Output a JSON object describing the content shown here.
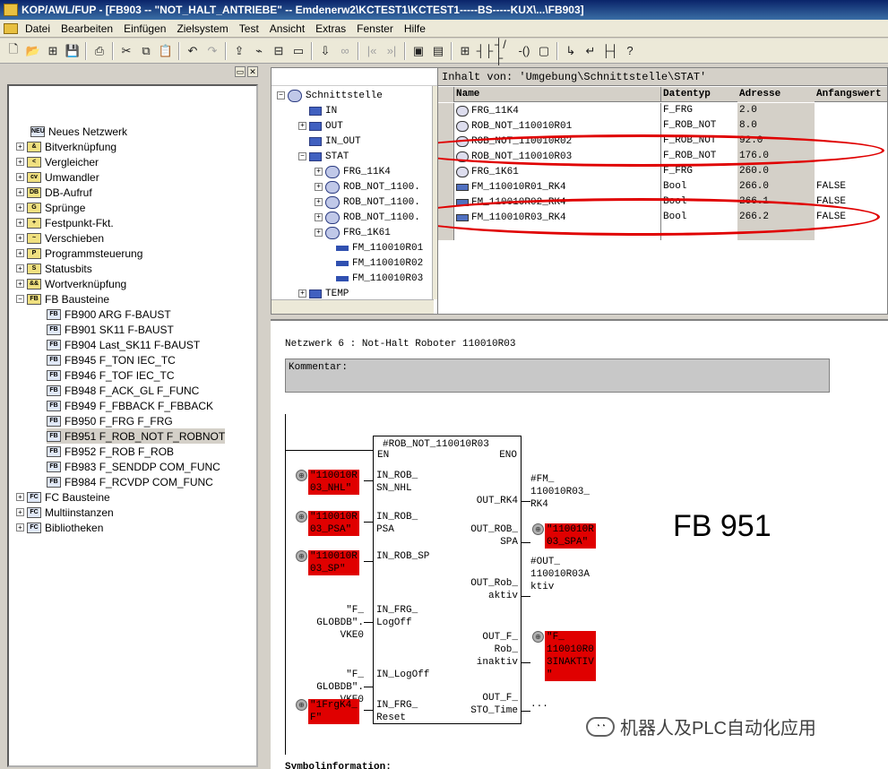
{
  "window": {
    "title": "KOP/AWL/FUP - [FB903 -- \"NOT_HALT_ANTRIEBE\" -- Emdenerw2\\KCTEST1\\KCTEST1-----BS-----KUX\\...\\FB903]"
  },
  "menu": [
    "Datei",
    "Bearbeiten",
    "Einfügen",
    "Zielsystem",
    "Test",
    "Ansicht",
    "Extras",
    "Fenster",
    "Hilfe"
  ],
  "toolbar": [
    {
      "icon": "new-icon",
      "glyph": "🗋"
    },
    {
      "icon": "open-icon",
      "glyph": "📂"
    },
    {
      "icon": "network-icon",
      "glyph": "⊞"
    },
    {
      "icon": "save-icon",
      "glyph": "💾"
    },
    {
      "icon": "print-icon",
      "glyph": "⎙"
    },
    {
      "icon": "cut-icon",
      "glyph": "✂"
    },
    {
      "icon": "copy-icon",
      "glyph": "⧉"
    },
    {
      "icon": "paste-icon",
      "glyph": "📋"
    },
    {
      "icon": "undo-icon",
      "glyph": "↶"
    },
    {
      "icon": "redo-icon",
      "glyph": "↷"
    },
    {
      "icon": "load-icon",
      "glyph": "⇪"
    },
    {
      "icon": "online-icon",
      "glyph": "⌁"
    },
    {
      "icon": "compare-icon",
      "glyph": "⊟"
    },
    {
      "icon": "monitor-icon",
      "glyph": "▭"
    },
    {
      "icon": "download-icon",
      "glyph": "⇩"
    },
    {
      "icon": "glasses-icon",
      "glyph": "∞"
    },
    {
      "icon": "prev-icon",
      "glyph": "|«"
    },
    {
      "icon": "next-icon",
      "glyph": "»|"
    },
    {
      "icon": "overview-icon",
      "glyph": "▣"
    },
    {
      "icon": "details-icon",
      "glyph": "▤"
    },
    {
      "icon": "new-network-icon",
      "glyph": "⊞"
    },
    {
      "icon": "no-contact-icon",
      "glyph": "┤├"
    },
    {
      "icon": "nc-contact-icon",
      "glyph": "┤/├"
    },
    {
      "icon": "coil-icon",
      "glyph": "-()"
    },
    {
      "icon": "box-icon",
      "glyph": "▢"
    },
    {
      "icon": "branch-open-icon",
      "glyph": "↳"
    },
    {
      "icon": "branch-close-icon",
      "glyph": "↵"
    },
    {
      "icon": "connection-icon",
      "glyph": "├┤"
    },
    {
      "icon": "help-icon",
      "glyph": "?"
    }
  ],
  "left_tree": {
    "new_network": "Neues Netzwerk",
    "folders": [
      "Bitverknüpfung",
      "Vergleicher",
      "Umwandler",
      "DB-Aufruf",
      "Sprünge",
      "Festpunkt-Fkt.",
      "Verschieben",
      "Programmsteuerung",
      "Statusbits",
      "Wortverknüpfung",
      "FB Bausteine"
    ],
    "fb_items": [
      {
        "label": "FB900   ARG   F-BAUST"
      },
      {
        "label": "FB901   SK11   F-BAUST"
      },
      {
        "label": "FB904   Last_SK11   F-BAUST"
      },
      {
        "label": "FB945   F_TON   IEC_TC"
      },
      {
        "label": "FB946   F_TOF   IEC_TC"
      },
      {
        "label": "FB948   F_ACK_GL   F_FUNC"
      },
      {
        "label": "FB949   F_FBBACK   F_FBBACK"
      },
      {
        "label": "FB950   F_FRG   F_FRG"
      },
      {
        "label": "FB951   F_ROB_NOT   F_ROBNOT"
      },
      {
        "label": "FB952   F_ROB   F_ROB"
      },
      {
        "label": "FB983   F_SENDDP   COM_FUNC"
      },
      {
        "label": "FB984   F_RCVDP   COM_FUNC"
      }
    ],
    "selected_fb": "FB951   F_ROB_NOT   F_ROBNOT",
    "bottom": [
      "FC Bausteine",
      "Multiinstanzen",
      "Bibliotheken"
    ]
  },
  "interface_tree": {
    "root": "Schnittstelle",
    "items": [
      {
        "label": "IN",
        "icon": "in"
      },
      {
        "label": "OUT",
        "icon": "in"
      },
      {
        "label": "IN_OUT",
        "icon": "in"
      },
      {
        "label": "STAT",
        "icon": "in"
      },
      {
        "label": "FRG_11K4",
        "icon": "fb"
      },
      {
        "label": "ROB_NOT_1100.",
        "icon": "fb"
      },
      {
        "label": "ROB_NOT_1100.",
        "icon": "fb"
      },
      {
        "label": "ROB_NOT_1100.",
        "icon": "fb"
      },
      {
        "label": "FRG_1K61",
        "icon": "fb"
      },
      {
        "label": "FM_110010R01",
        "icon": "var"
      },
      {
        "label": "FM_110010R02",
        "icon": "var"
      },
      {
        "label": "FM_110010R03",
        "icon": "var"
      },
      {
        "label": "TEMP",
        "icon": "in"
      }
    ]
  },
  "table": {
    "title": "Inhalt von: 'Umgebung\\Schnittstelle\\STAT'",
    "headers": {
      "name": "Name",
      "type": "Datentyp",
      "address": "Adresse",
      "init": "Anfangswert"
    },
    "rows": [
      {
        "name": "FRG_11K4",
        "type": "F_FRG",
        "address": "2.0",
        "init": "",
        "icon": "fb"
      },
      {
        "name": "ROB_NOT_110010R01",
        "type": "F_ROB_NOT",
        "address": "8.0",
        "init": "",
        "icon": "fb"
      },
      {
        "name": "ROB_NOT_110010R02",
        "type": "F_ROB_NOT",
        "address": "92.0",
        "init": "",
        "icon": "fb"
      },
      {
        "name": "ROB_NOT_110010R03",
        "type": "F_ROB_NOT",
        "address": "176.0",
        "init": "",
        "icon": "fb"
      },
      {
        "name": "FRG_1K61",
        "type": "F_FRG",
        "address": "260.0",
        "init": "",
        "icon": "fb"
      },
      {
        "name": "FM_110010R01_RK4",
        "type": "Bool",
        "address": "266.0",
        "init": "FALSE",
        "icon": "var"
      },
      {
        "name": "FM_110010R02_RK4",
        "type": "Bool",
        "address": "266.1",
        "init": "FALSE",
        "icon": "var"
      },
      {
        "name": "FM_110010R03_RK4",
        "type": "Bool",
        "address": "266.2",
        "init": "FALSE",
        "icon": "var"
      }
    ]
  },
  "network": {
    "title": "Netzwerk 6 : Not-Halt Roboter 110010R03",
    "comment_label": "Kommentar:",
    "block_instance": "#ROB_NOT_110010R03",
    "en": "EN",
    "eno": "ENO",
    "inputs": [
      {
        "param": "IN_ROB_\nSN_NHL",
        "actual": "\"110010R\n03_NHL\"",
        "red": true
      },
      {
        "param": "IN_ROB_\nPSA",
        "actual": "\"110010R\n03_PSA\"",
        "red": true
      },
      {
        "param": "IN_ROB_SP",
        "actual": "\"110010R\n03_SP\"",
        "red": true
      },
      {
        "param": "IN_FRG_\nLogOff",
        "actual": "\"F_\nGLOBDB\".\nVKE0",
        "red": false
      },
      {
        "param": "IN_LogOff",
        "actual": "\"F_\nGLOBDB\".\nVKE0",
        "red": false
      },
      {
        "param": "IN_FRG_\nReset",
        "actual": "\"1FrgK4_\nF\"",
        "red": true
      }
    ],
    "outputs": [
      {
        "param": "OUT_RK4",
        "actual": "#FM_\n110010R03_\nRK4",
        "red": false
      },
      {
        "param": "OUT_ROB_\nSPA",
        "actual": "\"110010R\n03_SPA\"",
        "red": true
      },
      {
        "param": "OUT_Rob_\naktiv",
        "actual": "#OUT_\n110010R03A\nktiv",
        "red": false
      },
      {
        "param": "OUT_F_\nRob_\ninaktiv",
        "actual": "\"F_\n110010R0\n3INAKTIV\n\"",
        "red": true
      },
      {
        "param": "OUT_F_\nSTO_Time",
        "actual": "...",
        "red": false
      }
    ],
    "fb_label": "FB 951",
    "watermark": "机器人及PLC自动化应用",
    "symbol_info": "Symbolinformation:"
  }
}
